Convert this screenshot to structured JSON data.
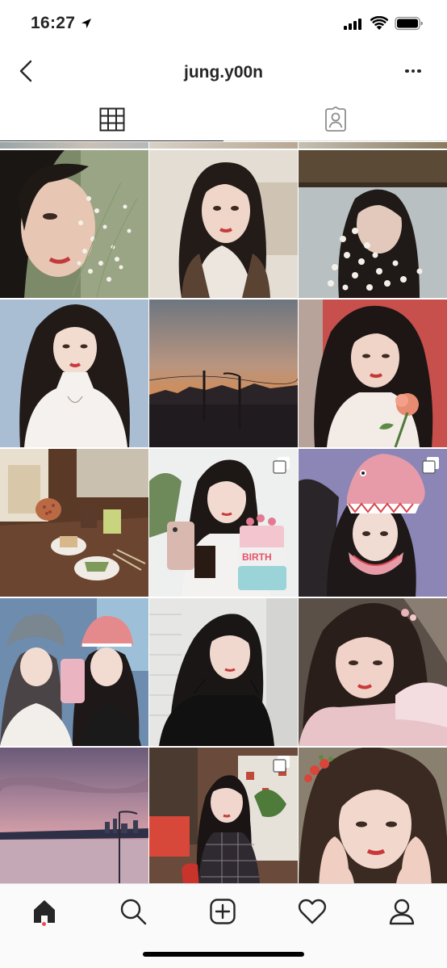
{
  "status_bar": {
    "time": "16:27",
    "icons": [
      "location-arrow-icon",
      "signal-icon",
      "wifi-icon",
      "battery-icon"
    ]
  },
  "header": {
    "title": "jung.y00n",
    "back_icon": "chevron-left-icon",
    "more_icon": "more-horizontal-icon"
  },
  "tabs": [
    {
      "name": "grid",
      "icon": "grid-icon",
      "selected": true
    },
    {
      "name": "tagged",
      "icon": "tagged-person-icon",
      "selected": false
    }
  ],
  "posts": [
    {
      "subject": "woman-with-babys-breath-flowers",
      "multi": false
    },
    {
      "subject": "woman-in-white-turtleneck-brown-coat",
      "multi": false
    },
    {
      "subject": "woman-behind-white-flowers",
      "multi": false
    },
    {
      "subject": "woman-white-turtleneck-blue-wall",
      "multi": false
    },
    {
      "subject": "sunset-city-streetlight",
      "multi": false
    },
    {
      "subject": "woman-holding-rose-red-background",
      "multi": false
    },
    {
      "subject": "cafe-desserts-drinks",
      "multi": false
    },
    {
      "subject": "woman-birthday-cake-phone",
      "multi": true
    },
    {
      "subject": "woman-shark-hat-purple-background",
      "multi": true
    },
    {
      "subject": "two-women-shark-hats-selfie",
      "multi": false
    },
    {
      "subject": "woman-black-dress-white-wall",
      "multi": false
    },
    {
      "subject": "woman-pink-fur-jacket",
      "multi": false
    },
    {
      "subject": "pink-sky-river-city",
      "multi": false
    },
    {
      "subject": "woman-plaid-jacket-shop",
      "multi": true
    },
    {
      "subject": "woman-hands-on-face-strawberry-clips",
      "multi": false
    }
  ],
  "bottom_nav": [
    {
      "name": "home",
      "icon": "home-icon",
      "active": true
    },
    {
      "name": "search",
      "icon": "search-icon",
      "active": false
    },
    {
      "name": "new-post",
      "icon": "add-post-icon",
      "active": false
    },
    {
      "name": "activity",
      "icon": "heart-icon",
      "active": false
    },
    {
      "name": "profile",
      "icon": "profile-icon",
      "active": false
    }
  ],
  "colors": {
    "text": "#262626",
    "divider": "#dbdbdb",
    "bottom_bar_bg": "#fafafa",
    "notification_dot": "#ed4956"
  }
}
